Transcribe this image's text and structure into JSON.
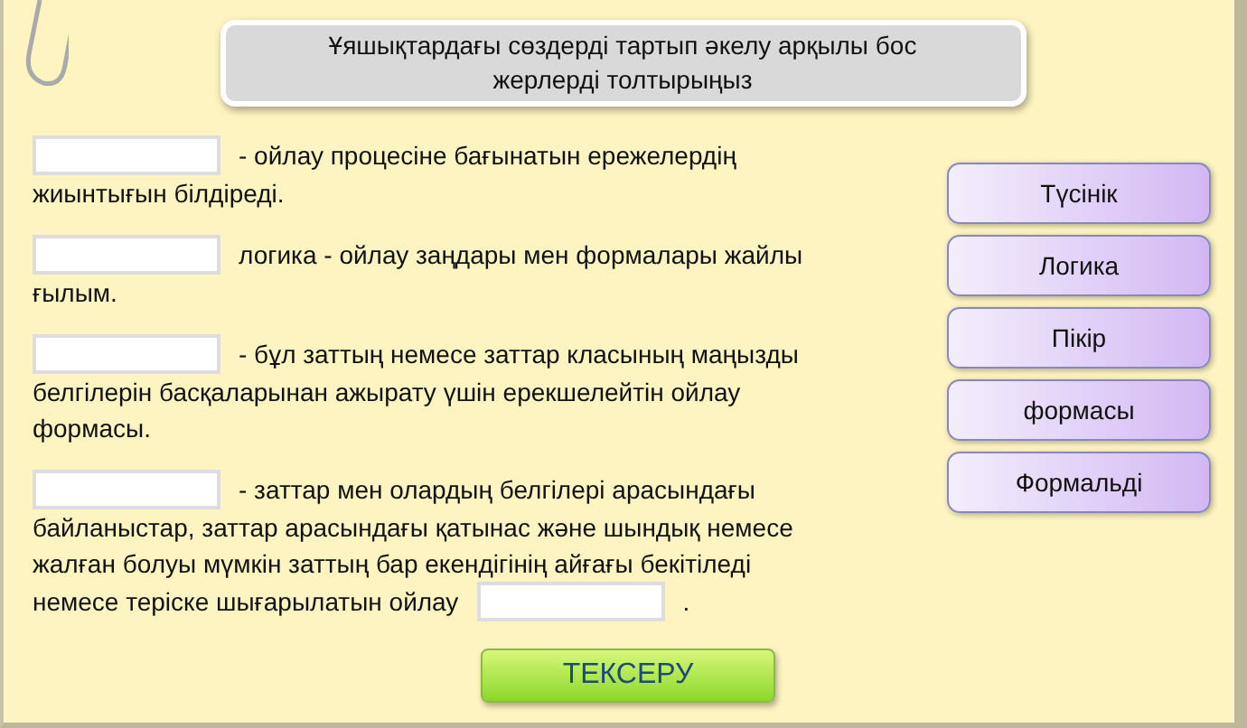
{
  "title": "Ұяшықтардағы сөздерді тартып әкелу арқылы бос жерлерді толтырыңыз",
  "items": [
    {
      "lines": [
        [
          {
            "kind": "blank"
          },
          {
            "kind": "text",
            "text": "- ойлау процесіне бағынатын ережелердің"
          }
        ],
        [
          {
            "kind": "text",
            "text": "жиынтығын білдіреді."
          }
        ]
      ]
    },
    {
      "lines": [
        [
          {
            "kind": "blank"
          },
          {
            "kind": "text",
            "text": "логика - ойлау заңдары мен формалары жайлы"
          }
        ],
        [
          {
            "kind": "text",
            "text": "ғылым."
          }
        ]
      ]
    },
    {
      "lines": [
        [
          {
            "kind": "blank"
          },
          {
            "kind": "text",
            "text": "- бұл заттың немесе заттар класының маңызды"
          }
        ],
        [
          {
            "kind": "text",
            "text": "белгілерін басқаларынан ажырату үшін ерекшелейтін ойлау"
          }
        ],
        [
          {
            "kind": "text",
            "text": "формасы."
          }
        ]
      ]
    },
    {
      "lines": [
        [
          {
            "kind": "blank"
          },
          {
            "kind": "text",
            "text": "- заттар мен олардың белгілері арасындағы"
          }
        ],
        [
          {
            "kind": "text",
            "text": "байланыстар, заттар арасындағы қатынас және  шындық немесе"
          }
        ],
        [
          {
            "kind": "text",
            "text": "жалған болуы мүмкін заттың бар екендігінің айғағы бекітіледі"
          }
        ],
        [
          {
            "kind": "text",
            "text": "немесе теріске шығарылатын ойлау"
          },
          {
            "kind": "blank"
          },
          {
            "kind": "text",
            "text": "."
          }
        ]
      ]
    }
  ],
  "words": [
    "Түсінік",
    "Логика",
    "Пікір",
    "формасы",
    "Формальді"
  ],
  "check_button": "ТЕКСЕРУ"
}
